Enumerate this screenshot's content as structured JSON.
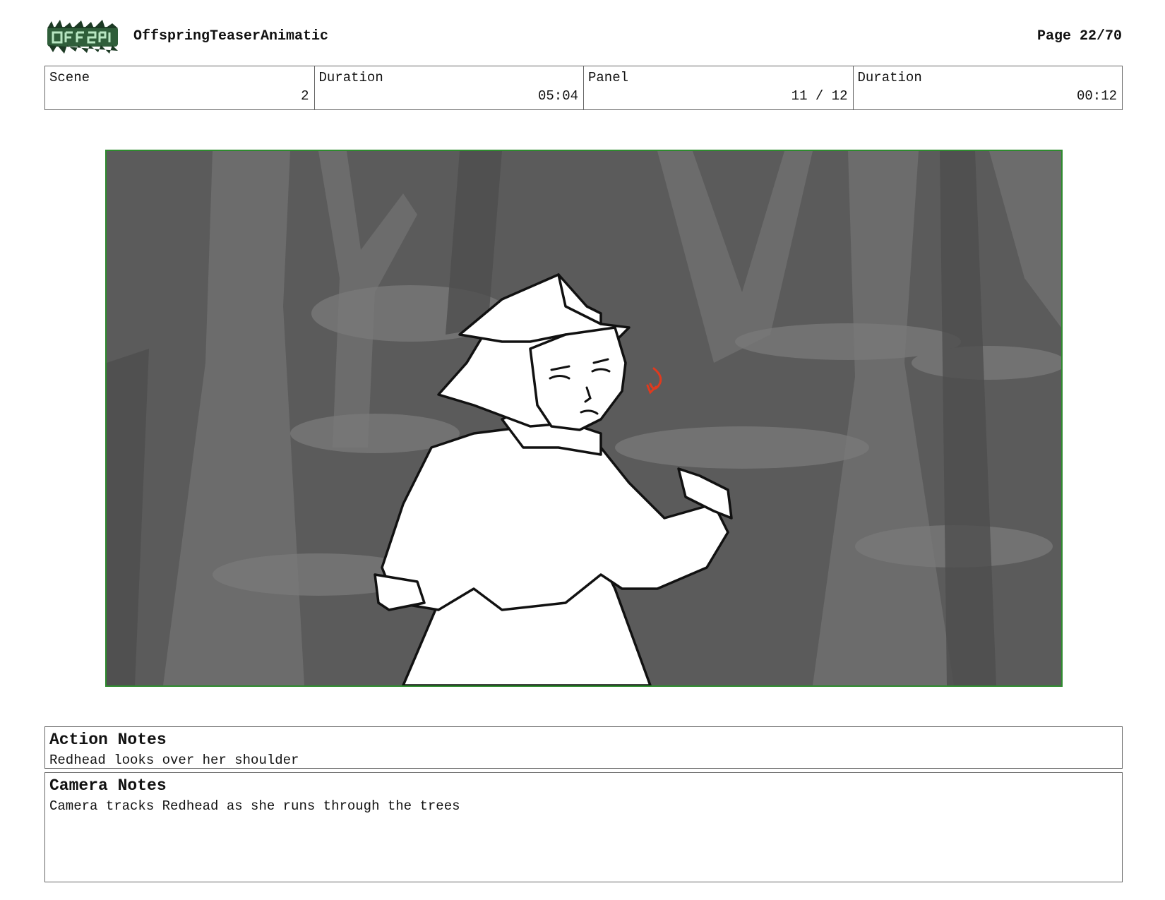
{
  "header": {
    "project_title": "OffspringTeaserAnimatic",
    "page_label": "Page 22/70",
    "logo_icon": "offspring-logo"
  },
  "info": {
    "scene_label": "Scene",
    "scene_value": "2",
    "scene_duration_label": "Duration",
    "scene_duration_value": "05:04",
    "panel_label": "Panel",
    "panel_value": "11 / 12",
    "panel_duration_label": "Duration",
    "panel_duration_value": "00:12"
  },
  "panel": {
    "frame_color": "#2e8b2e",
    "background_color": "#5a5a5a",
    "motion_arrow_color": "#e03a1e"
  },
  "action_notes": {
    "heading": "Action Notes",
    "text": "Redhead looks over her shoulder"
  },
  "camera_notes": {
    "heading": "Camera Notes",
    "text": "Camera tracks Redhead as she runs through the trees"
  }
}
